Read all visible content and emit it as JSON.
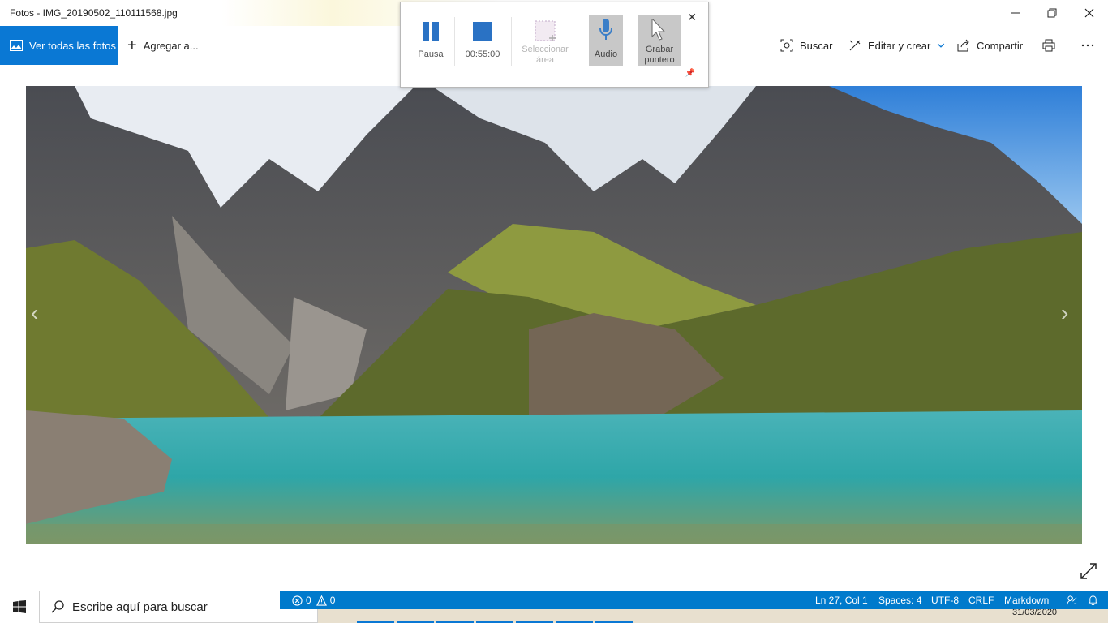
{
  "window": {
    "title": "Fotos - IMG_20190502_110111568.jpg"
  },
  "toolbar": {
    "view_all_label": "Ver todas las fotos",
    "add_to_label": "Agregar a...",
    "search_label": "Buscar",
    "edit_create_label": "Editar y crear",
    "share_label": "Compartir"
  },
  "recorder": {
    "pause_label": "Pausa",
    "timer": "00:55:00",
    "select_area_label": "Seleccionar área",
    "audio_label": "Audio",
    "record_pointer_label": "Grabar puntero"
  },
  "statusbar": {
    "errors": "0",
    "warnings": "0",
    "position": "Ln 27, Col 1",
    "spaces": "Spaces: 4",
    "encoding": "UTF-8",
    "eol": "CRLF",
    "language": "Markdown"
  },
  "taskbar": {
    "search_placeholder": "Escribe aquí para buscar",
    "date": "31/03/2020"
  },
  "colors": {
    "accent": "#0a78d4",
    "statusbar": "#007acc",
    "recorder_active": "#c8c8c8"
  }
}
